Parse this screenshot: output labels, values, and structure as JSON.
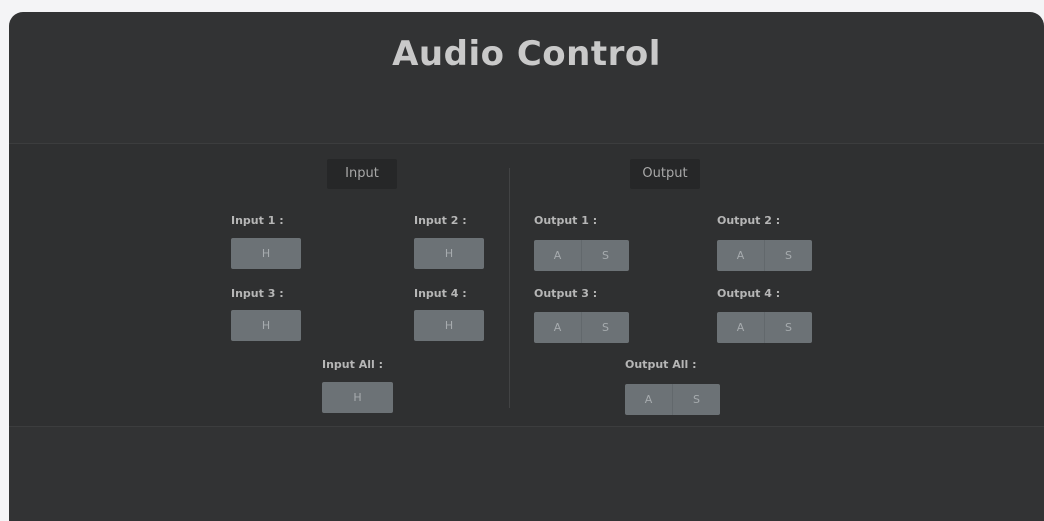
{
  "title": "Audio Control",
  "input": {
    "header": "Input",
    "channels": [
      {
        "label": "Input 1 :",
        "button": "H"
      },
      {
        "label": "Input 2 :",
        "button": "H"
      },
      {
        "label": "Input 3 :",
        "button": "H"
      },
      {
        "label": "Input 4 :",
        "button": "H"
      }
    ],
    "all": {
      "label": "Input All :",
      "button": "H"
    }
  },
  "output": {
    "header": "Output",
    "channels": [
      {
        "label": "Output 1 :",
        "button_a": "A",
        "button_s": "S"
      },
      {
        "label": "Output 2 :",
        "button_a": "A",
        "button_s": "S"
      },
      {
        "label": "Output 3 :",
        "button_a": "A",
        "button_s": "S"
      },
      {
        "label": "Output 4 :",
        "button_a": "A",
        "button_s": "S"
      }
    ],
    "all": {
      "label": "Output All :",
      "button_a": "A",
      "button_s": "S"
    }
  }
}
